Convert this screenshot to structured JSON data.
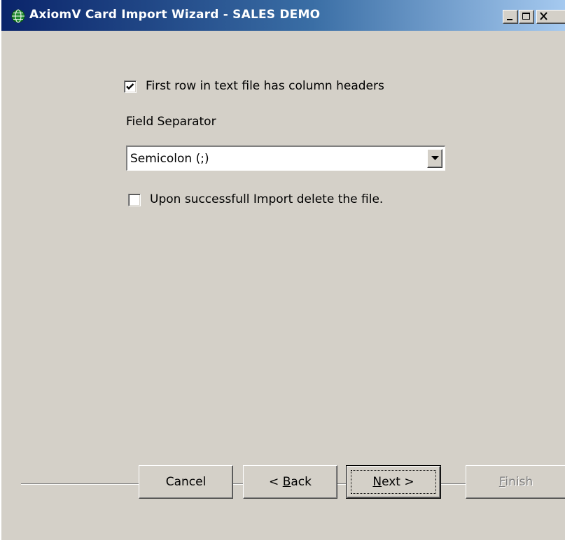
{
  "window": {
    "title": "AxiomV  Card Import Wizard - SALES DEMO",
    "icon": "globe-icon",
    "controls": [
      "minimize-icon",
      "maximize-icon",
      "close-icon"
    ]
  },
  "options": {
    "first_row_headers": {
      "label": "First row in text file has column headers",
      "checked": true
    },
    "field_separator": {
      "label": "Field Separator",
      "selected": "Semicolon (;)"
    },
    "delete_after_import": {
      "label": "Upon successfull Import delete the file.",
      "checked": false
    }
  },
  "buttons": {
    "cancel": "Cancel",
    "back_prefix": "< ",
    "back_mnemonic": "B",
    "back_rest": "ack",
    "next_mnemonic": "N",
    "next_rest": "ext >",
    "finish_mnemonic": "F",
    "finish_rest": "inish",
    "finish_enabled": false
  },
  "colors": {
    "title_bar_start": "#0a246a",
    "title_bar_end": "#a6caf0",
    "dialog_face": "#d4d0c8",
    "disabled_text": "#808080"
  }
}
